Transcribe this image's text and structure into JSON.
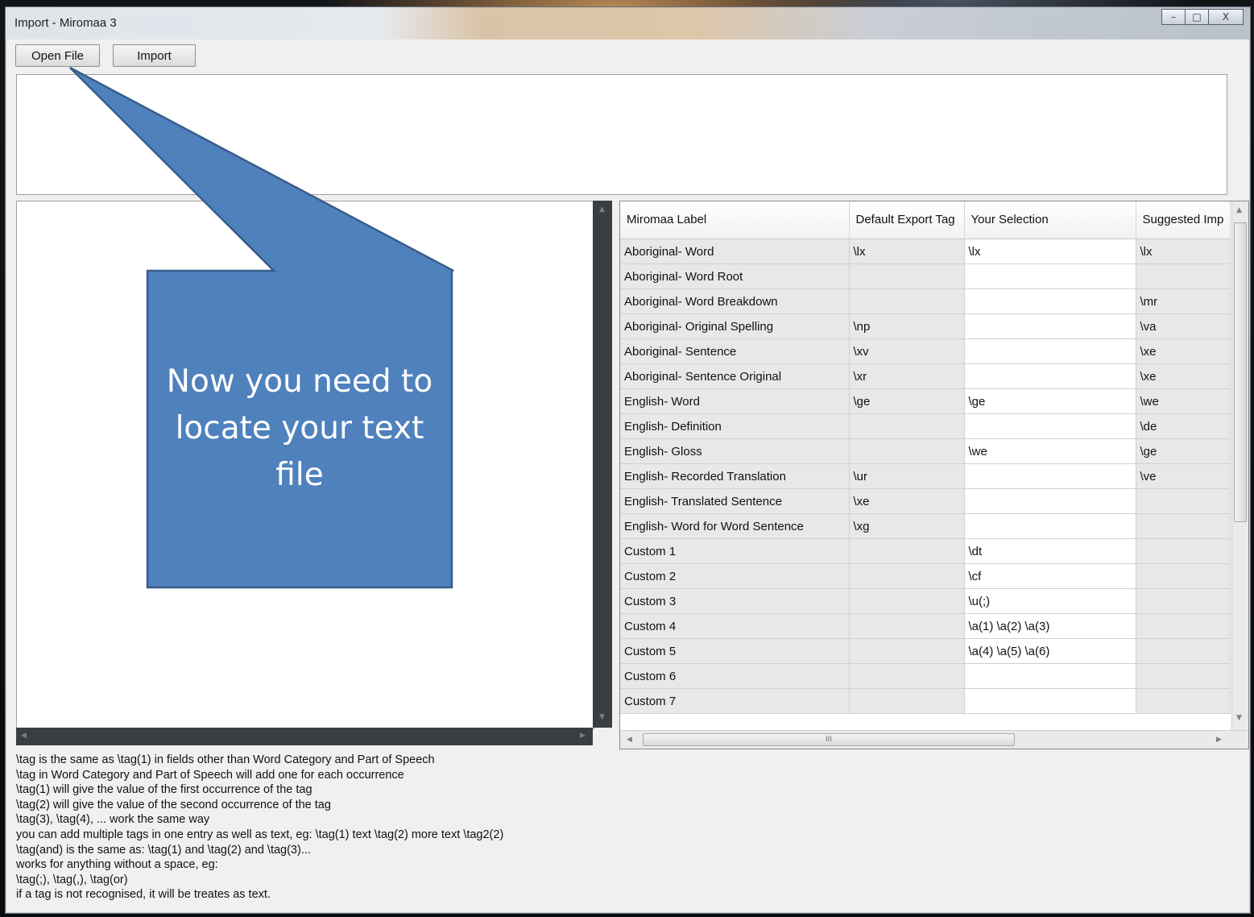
{
  "window": {
    "title": "Import - Miromaa 3",
    "controls": {
      "minimize": "–",
      "maximize": "□",
      "close": "X"
    }
  },
  "toolbar": {
    "open_file": "Open File",
    "import": "Import"
  },
  "table": {
    "headers": [
      "Miromaa Label",
      "Default Export Tag",
      "Your Selection",
      "Suggested Imp"
    ],
    "rows": [
      [
        "Aboriginal-  Word",
        "\\lx",
        "\\lx",
        "\\lx"
      ],
      [
        "Aboriginal- Word Root",
        "",
        "",
        ""
      ],
      [
        "Aboriginal- Word Breakdown",
        "",
        "",
        "\\mr"
      ],
      [
        "Aboriginal- Original Spelling",
        "\\np",
        "",
        "\\va"
      ],
      [
        "Aboriginal- Sentence",
        "\\xv",
        "",
        "\\xe"
      ],
      [
        "Aboriginal- Sentence Original",
        "\\xr",
        "",
        "\\xe"
      ],
      [
        "English- Word",
        "\\ge",
        "\\ge",
        "\\we"
      ],
      [
        "English- Definition",
        "",
        "",
        "\\de"
      ],
      [
        "English- Gloss",
        "",
        "\\we",
        "\\ge"
      ],
      [
        "English- Recorded Translation",
        "\\ur",
        "",
        "\\ve"
      ],
      [
        "English- Translated Sentence",
        "\\xe",
        "",
        ""
      ],
      [
        "English- Word for Word Sentence",
        "\\xg",
        "",
        ""
      ],
      [
        "Custom 1",
        "",
        "\\dt",
        ""
      ],
      [
        "Custom 2",
        "",
        "\\cf",
        ""
      ],
      [
        "Custom 3",
        "",
        "\\u(;)",
        ""
      ],
      [
        "Custom 4",
        "",
        "\\a(1) \\a(2) \\a(3)",
        ""
      ],
      [
        "Custom 5",
        "",
        "\\a(4) \\a(5) \\a(6)",
        ""
      ],
      [
        "Custom 6",
        "",
        "",
        ""
      ],
      [
        "Custom 7",
        "",
        "",
        ""
      ]
    ],
    "hscroll_grip": "III"
  },
  "help_lines": [
    "\\tag is the same as \\tag(1) in fields other than Word Category and Part of Speech",
    "\\tag in Word Category and Part of Speech will add one for each occurrence",
    "\\tag(1) will give the value of the first occurrence of the tag",
    "\\tag(2) will give the value of the second occurrence of the tag",
    "\\tag(3), \\tag(4), ... work the same way",
    "you can add multiple tags in one entry as well as text, eg: \\tag(1) text \\tag(2) more text \\tag2(2)",
    "\\tag(and) is the same as: \\tag(1) and \\tag(2) and \\tag(3)...",
    "works for anything without a space, eg:",
    "\\tag(;), \\tag(,), \\tag(or)",
    "if a tag is not recognised, it will be treates as text."
  ],
  "callout": {
    "lines": [
      "Now you need to",
      "locate your text",
      "file"
    ],
    "fill": "#4f81bd",
    "stroke": "#385d8a"
  }
}
